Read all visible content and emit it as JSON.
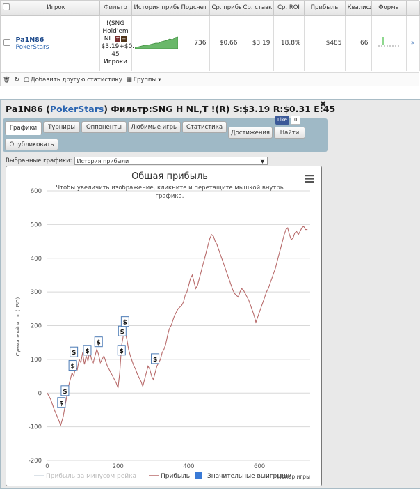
{
  "table": {
    "headers": [
      "Игрок",
      "Фильтр",
      "История прибы",
      "Подсчет",
      "Ср. прибы",
      "Ср. ставк",
      "Ср. ROI",
      "Прибыль",
      "Квалиф",
      "Форма"
    ],
    "row": {
      "player": "Pa1N86",
      "site": "PokerStars",
      "filter_lines": [
        "!(SNG",
        "Hold'em",
        "NL",
        "$3.19+$0.",
        "45",
        "Игроки"
      ],
      "count": "736",
      "avg_profit": "$0.66",
      "avg_stake": "$3.19",
      "avg_roi": "18.8%",
      "profit": "$485",
      "qualif": "66"
    }
  },
  "toolbar": {
    "add_stat": "Добавить другую статистику",
    "groups": "Группы"
  },
  "dialog": {
    "title_player": "Pa1N86",
    "title_site": "PokerStars",
    "title_rest": "Фильтр:SNG H NL,T !(R) S:$3.19 R:$0.31 E:45",
    "tabs": [
      "Графики",
      "Турниры",
      "Оппоненты",
      "Любимые игры",
      "Статистика",
      "Достижения",
      "Найти",
      "Опубликовать"
    ],
    "like_label": "Like",
    "like_count": "0",
    "select_label": "Выбранные графики:",
    "select_value": "История прибыли"
  },
  "chart_data": {
    "type": "line",
    "title": "Общая прибыль",
    "subtitle": "Чтобы увеличить изображение, кликните и перетащите мышкой внутрь графика.",
    "ylabel": "Суммарный итог (USD)",
    "xlabel": "Номер игры",
    "xlim": [
      0,
      736
    ],
    "ylim": [
      -200,
      600
    ],
    "xticks": [
      "0",
      "200",
      "400",
      "600"
    ],
    "yticks": [
      "-200",
      "-100",
      "0",
      "100",
      "200",
      "300",
      "400",
      "500",
      "600"
    ],
    "grid": true,
    "legend_position": "bottom",
    "legend": [
      "Прибыль за минусом рейка",
      "Прибыль",
      "Значительные выигрыши"
    ],
    "series": [
      {
        "name": "Прибыль",
        "color": "#b86b6b",
        "points": [
          [
            0,
            0
          ],
          [
            10,
            -20
          ],
          [
            20,
            -50
          ],
          [
            30,
            -75
          ],
          [
            38,
            -95
          ],
          [
            45,
            -70
          ],
          [
            50,
            -40
          ],
          [
            55,
            -10
          ],
          [
            60,
            20
          ],
          [
            65,
            40
          ],
          [
            70,
            60
          ],
          [
            75,
            50
          ],
          [
            80,
            80
          ],
          [
            85,
            70
          ],
          [
            90,
            100
          ],
          [
            95,
            90
          ],
          [
            100,
            120
          ],
          [
            105,
            85
          ],
          [
            110,
            110
          ],
          [
            115,
            95
          ],
          [
            120,
            125
          ],
          [
            125,
            100
          ],
          [
            130,
            90
          ],
          [
            135,
            110
          ],
          [
            140,
            130
          ],
          [
            145,
            115
          ],
          [
            150,
            90
          ],
          [
            155,
            100
          ],
          [
            160,
            110
          ],
          [
            165,
            95
          ],
          [
            170,
            80
          ],
          [
            175,
            70
          ],
          [
            180,
            60
          ],
          [
            185,
            50
          ],
          [
            190,
            40
          ],
          [
            195,
            30
          ],
          [
            200,
            15
          ],
          [
            205,
            60
          ],
          [
            210,
            140
          ],
          [
            215,
            170
          ],
          [
            220,
            180
          ],
          [
            225,
            160
          ],
          [
            230,
            130
          ],
          [
            235,
            110
          ],
          [
            240,
            95
          ],
          [
            245,
            80
          ],
          [
            250,
            70
          ],
          [
            255,
            55
          ],
          [
            260,
            45
          ],
          [
            265,
            35
          ],
          [
            270,
            20
          ],
          [
            275,
            40
          ],
          [
            280,
            60
          ],
          [
            285,
            80
          ],
          [
            290,
            70
          ],
          [
            295,
            50
          ],
          [
            300,
            40
          ],
          [
            305,
            60
          ],
          [
            310,
            80
          ],
          [
            315,
            90
          ],
          [
            320,
            100
          ],
          [
            325,
            120
          ],
          [
            330,
            130
          ],
          [
            335,
            145
          ],
          [
            340,
            170
          ],
          [
            345,
            190
          ],
          [
            350,
            200
          ],
          [
            355,
            215
          ],
          [
            360,
            230
          ],
          [
            365,
            240
          ],
          [
            370,
            250
          ],
          [
            375,
            255
          ],
          [
            380,
            260
          ],
          [
            385,
            270
          ],
          [
            390,
            290
          ],
          [
            395,
            300
          ],
          [
            400,
            320
          ],
          [
            405,
            340
          ],
          [
            410,
            350
          ],
          [
            415,
            330
          ],
          [
            420,
            310
          ],
          [
            425,
            320
          ],
          [
            430,
            340
          ],
          [
            435,
            360
          ],
          [
            440,
            380
          ],
          [
            445,
            400
          ],
          [
            450,
            420
          ],
          [
            455,
            440
          ],
          [
            460,
            460
          ],
          [
            465,
            470
          ],
          [
            470,
            465
          ],
          [
            475,
            450
          ],
          [
            480,
            440
          ],
          [
            485,
            425
          ],
          [
            490,
            410
          ],
          [
            495,
            395
          ],
          [
            500,
            380
          ],
          [
            505,
            365
          ],
          [
            510,
            350
          ],
          [
            515,
            335
          ],
          [
            520,
            320
          ],
          [
            525,
            305
          ],
          [
            530,
            295
          ],
          [
            535,
            290
          ],
          [
            540,
            285
          ],
          [
            545,
            300
          ],
          [
            550,
            310
          ],
          [
            555,
            305
          ],
          [
            560,
            295
          ],
          [
            565,
            285
          ],
          [
            570,
            275
          ],
          [
            575,
            260
          ],
          [
            580,
            245
          ],
          [
            585,
            230
          ],
          [
            590,
            210
          ],
          [
            595,
            225
          ],
          [
            600,
            240
          ],
          [
            605,
            255
          ],
          [
            610,
            270
          ],
          [
            615,
            285
          ],
          [
            620,
            300
          ],
          [
            625,
            310
          ],
          [
            630,
            325
          ],
          [
            635,
            340
          ],
          [
            640,
            355
          ],
          [
            645,
            370
          ],
          [
            650,
            390
          ],
          [
            655,
            410
          ],
          [
            660,
            430
          ],
          [
            665,
            450
          ],
          [
            670,
            470
          ],
          [
            675,
            485
          ],
          [
            680,
            490
          ],
          [
            685,
            470
          ],
          [
            690,
            455
          ],
          [
            695,
            460
          ],
          [
            700,
            475
          ],
          [
            705,
            480
          ],
          [
            710,
            470
          ],
          [
            715,
            480
          ],
          [
            720,
            490
          ],
          [
            725,
            495
          ],
          [
            730,
            485
          ],
          [
            736,
            485
          ]
        ]
      }
    ],
    "big_wins": [
      [
        40,
        -30
      ],
      [
        50,
        5
      ],
      [
        72,
        80
      ],
      [
        75,
        120
      ],
      [
        113,
        125
      ],
      [
        145,
        150
      ],
      [
        210,
        125
      ],
      [
        212,
        182
      ],
      [
        220,
        210
      ],
      [
        305,
        100
      ]
    ]
  }
}
